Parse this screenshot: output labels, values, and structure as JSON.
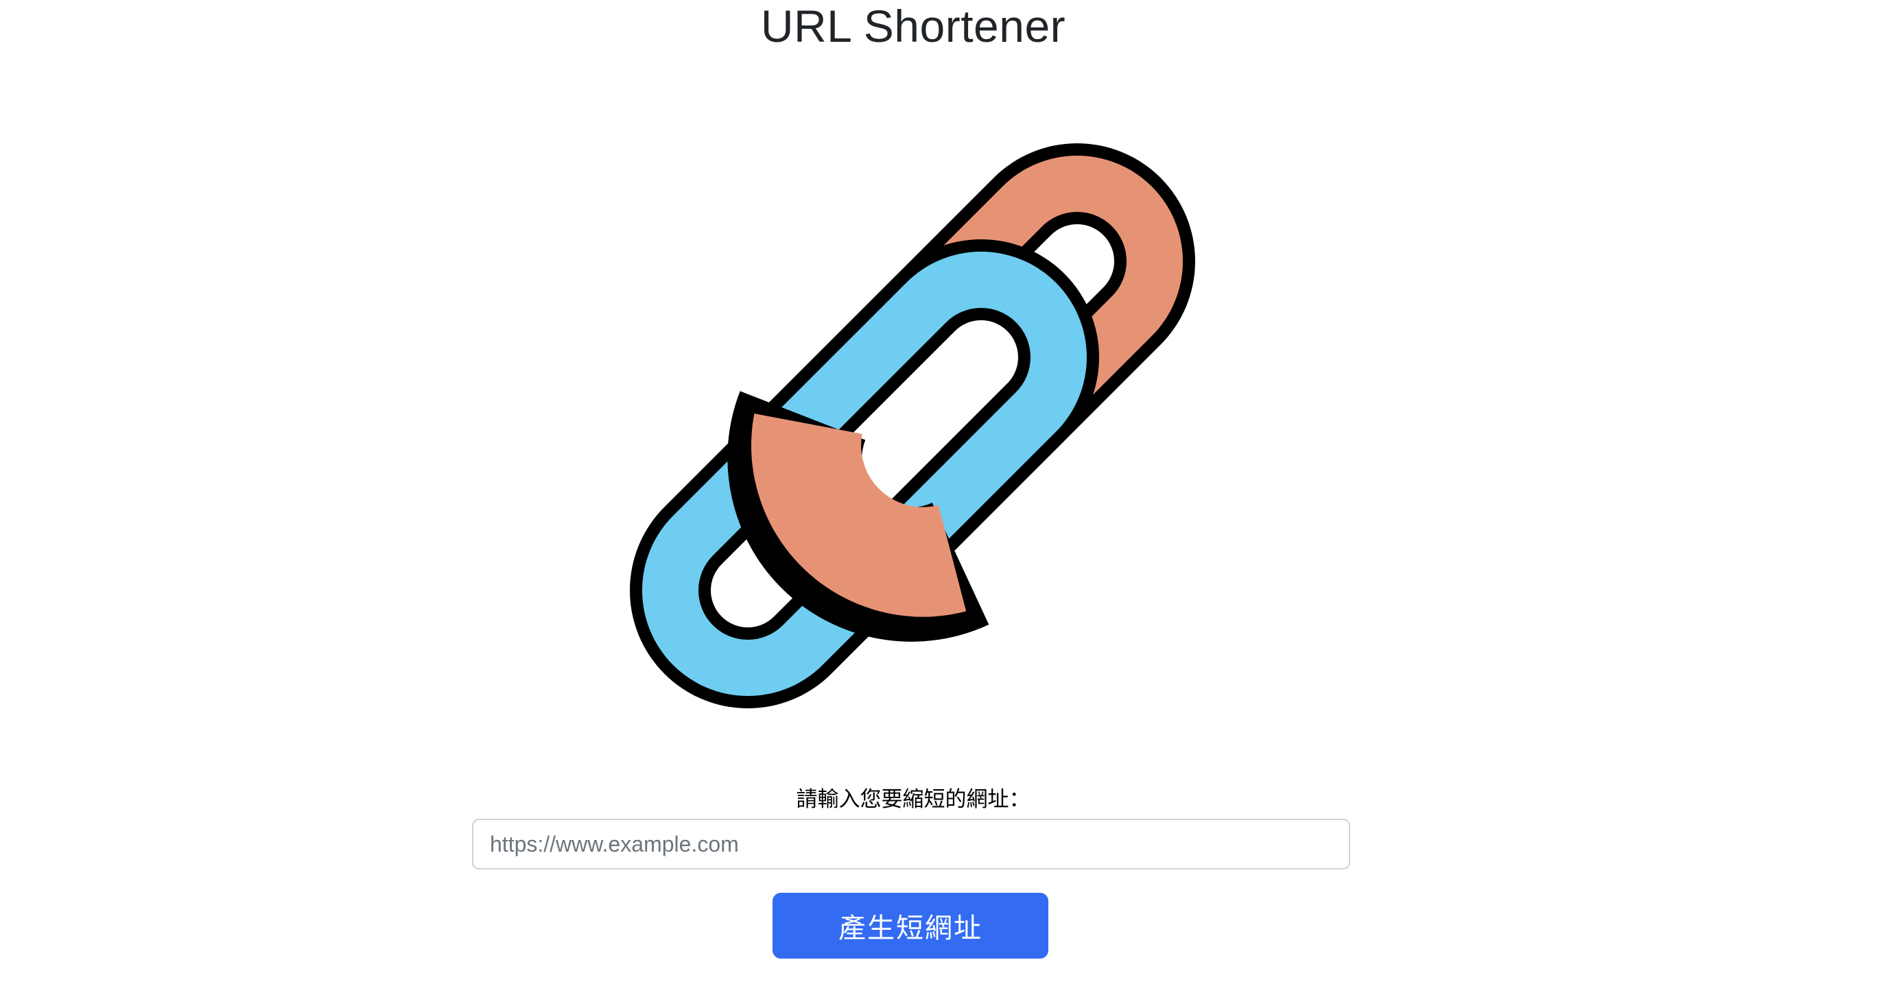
{
  "header": {
    "title": "URL Shortener"
  },
  "logo": {
    "icon": "chain-link-icon",
    "colors": {
      "left_link": "#6ecdf0",
      "right_link": "#e69375",
      "outline": "#000000"
    }
  },
  "form": {
    "prompt_label": "請輸入您要縮短的網址：",
    "url_input_value": "",
    "url_input_placeholder": "https://www.example.com",
    "submit_label": "產生短網址"
  },
  "colors": {
    "accent": "#336cf2",
    "input_border": "#ced4da"
  }
}
